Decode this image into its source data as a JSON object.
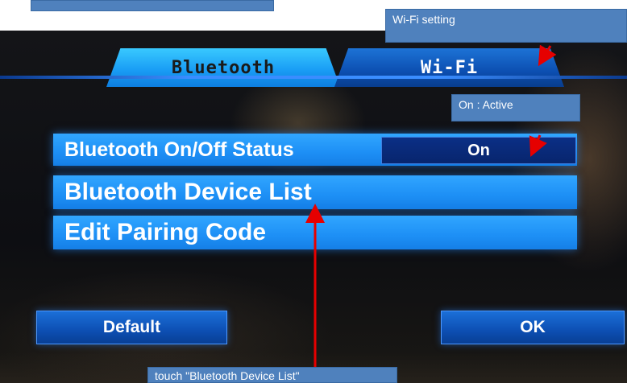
{
  "annotations": {
    "top_left_box": "",
    "wifi_setting": "Wi-Fi setting",
    "on_active": "On : Active",
    "touch_hint": "touch \"Bluetooth Device List\""
  },
  "tabs": [
    {
      "label": "Bluetooth",
      "active": true
    },
    {
      "label": "Wi-Fi",
      "active": false
    }
  ],
  "menu": {
    "status_label": "Bluetooth On/Off Status",
    "status_value": "On",
    "device_list": "Bluetooth Device List",
    "edit_pairing": "Edit Pairing Code"
  },
  "buttons": {
    "default": "Default",
    "ok": "OK"
  },
  "colors": {
    "annotation_box": "#4f81bd",
    "arrow_red": "#e60000",
    "menu_blue": "#1d8ff5"
  }
}
